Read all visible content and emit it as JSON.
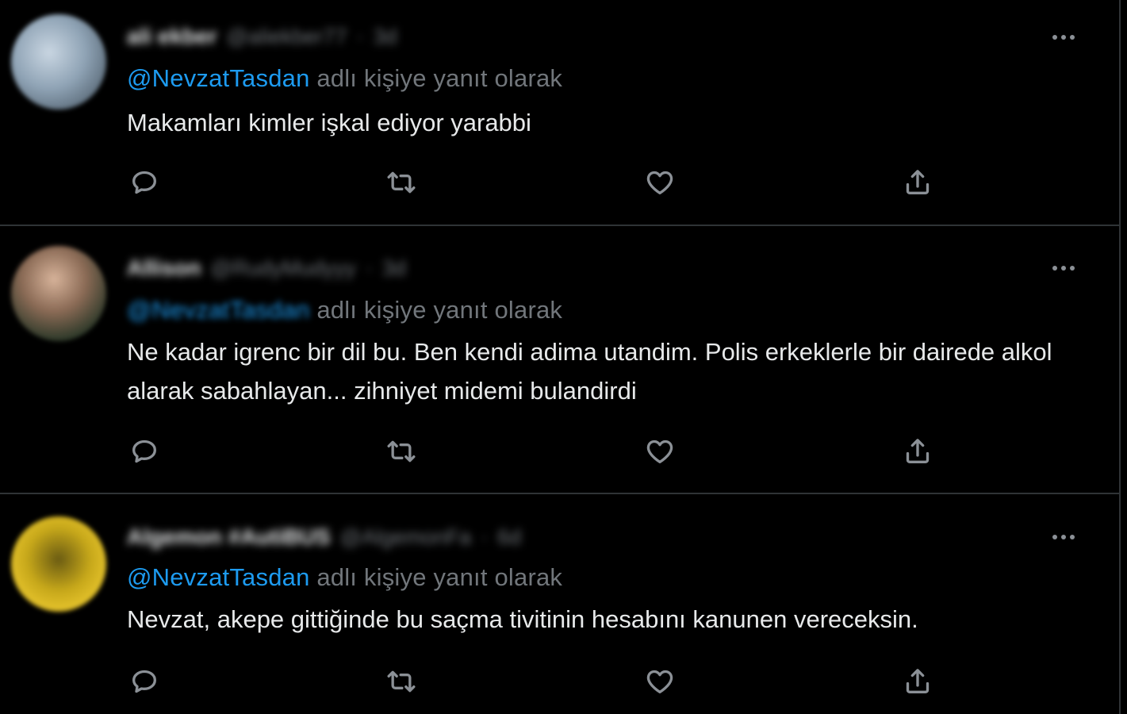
{
  "tweets": [
    {
      "display_name": "ali ekber",
      "handle": "@aliekber77",
      "time": "3d",
      "reply_prefix": "@NevzatTasdan",
      "reply_suffix": " adlı kişiye yanıt olarak",
      "text": "Makamları kimler işkal ediyor yarabbi"
    },
    {
      "display_name": "Allison",
      "handle": "@RudyMudyyy",
      "time": "3d",
      "reply_prefix": "@NevzatTasdan",
      "reply_suffix": " adlı kişiye yanıt olarak",
      "text": "Ne kadar igrenc bir dil bu. Ben kendi adima utandim. Polis erkeklerle bir dairede alkol alarak sabahlayan... zihniyet midemi bulandirdi"
    },
    {
      "display_name": "Algemon #AutiBUS",
      "handle": "@AlgemonFa",
      "time": "6d",
      "reply_prefix": "@NevzatTasdan",
      "reply_suffix": " adlı kişiye yanıt olarak",
      "text": "Nevzat, akepe gittiğinde bu saçma tivitinin hesabını kanunen vereceksin."
    }
  ],
  "separator": "·",
  "icons": {
    "reply": "reply-icon",
    "retweet": "retweet-icon",
    "like": "heart-icon",
    "share": "share-icon",
    "more": "more-dots-icon"
  },
  "colors": {
    "background": "#000000",
    "mention": "#1d9bf0",
    "secondary_text": "#71767b",
    "primary_text": "#e7e9ea",
    "divider": "#2f3336"
  }
}
